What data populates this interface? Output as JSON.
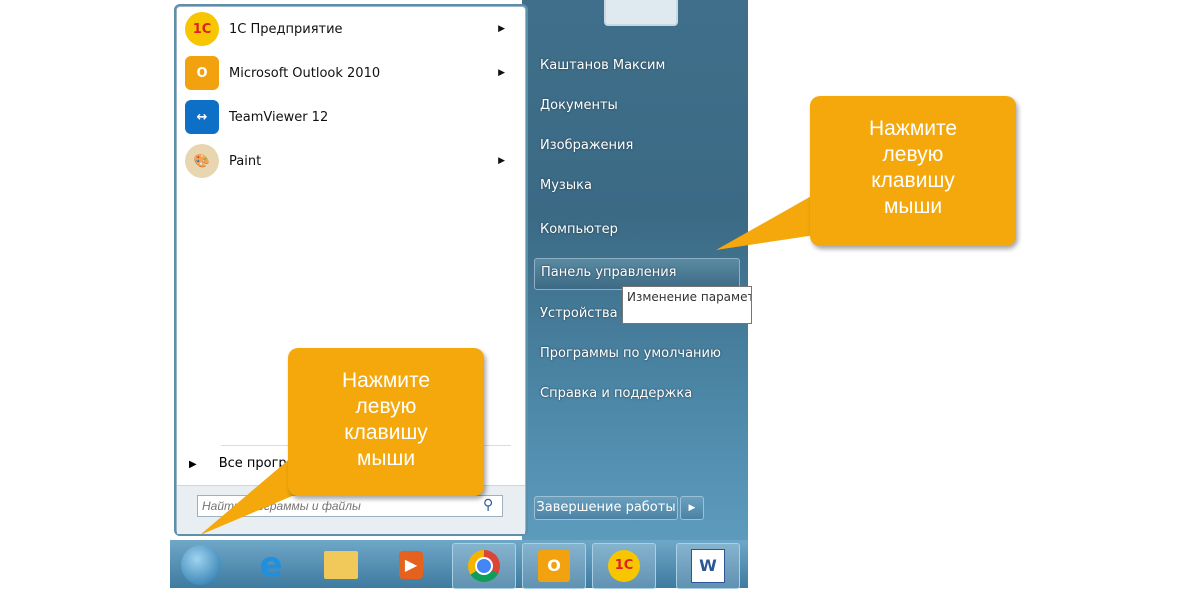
{
  "start_menu": {
    "programs": [
      {
        "label": "1С Предприятие",
        "icon": "1c-icon",
        "has_submenu": true
      },
      {
        "label": "Microsoft Outlook 2010",
        "icon": "outlook-icon",
        "has_submenu": true
      },
      {
        "label": "TeamViewer 12",
        "icon": "teamviewer-icon",
        "has_submenu": false
      },
      {
        "label": "Paint",
        "icon": "paint-icon",
        "has_submenu": true
      }
    ],
    "all_programs": "Все программы",
    "search_placeholder": "Найти программы и файлы",
    "right_items": [
      "Каштанов Максим",
      "Документы",
      "Изображения",
      "Музыка",
      "Компьютер",
      "Панель управления",
      "Устройства и принтеры",
      "Программы по умолчанию",
      "Справка и поддержка"
    ],
    "shutdown": "Завершение работы",
    "tooltip": "Изменение параметров компьютера."
  },
  "taskbar": {
    "icons": [
      "start-orb-icon",
      "internet-explorer-icon",
      "explorer-icon",
      "media-player-icon",
      "chrome-icon",
      "outlook-icon",
      "1c-icon",
      "word-icon"
    ]
  },
  "callouts": [
    {
      "text_lines": [
        "Нажмите",
        "левую",
        "клавишу",
        "мыши"
      ]
    },
    {
      "text_lines": [
        "Нажмите",
        "левую",
        "клавишу",
        "мыши"
      ]
    }
  ],
  "colors": {
    "callout": "#f4a80c",
    "menu_right": "#3f6f8a"
  }
}
